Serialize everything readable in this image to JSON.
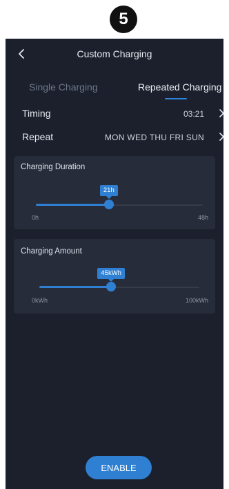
{
  "step_number": "5",
  "header": {
    "title": "Custom Charging"
  },
  "tabs": [
    {
      "label": "Single Charging",
      "active": false
    },
    {
      "label": "Repeated Charging",
      "active": true
    }
  ],
  "settings": {
    "timing": {
      "label": "Timing",
      "value": "03:21"
    },
    "repeat": {
      "label": "Repeat",
      "value": "MON WED THU FRI SUN"
    }
  },
  "duration": {
    "title": "Charging Duration",
    "value_label": "21h",
    "min_label": "0h",
    "max_label": "48h",
    "value": 21,
    "min": 0,
    "max": 48
  },
  "amount": {
    "title": "Charging Amount",
    "value_label": "45kWh",
    "min_label": "0kWh",
    "max_label": "100kWh",
    "value": 45,
    "min": 0,
    "max": 100
  },
  "enable_button": {
    "label": "ENABLE"
  },
  "colors": {
    "accent": "#2f80d2",
    "background": "#1b202c",
    "card": "#262c3a"
  },
  "icons": {
    "back": "chevron-left-icon",
    "row_arrow": "chevron-right-icon"
  }
}
